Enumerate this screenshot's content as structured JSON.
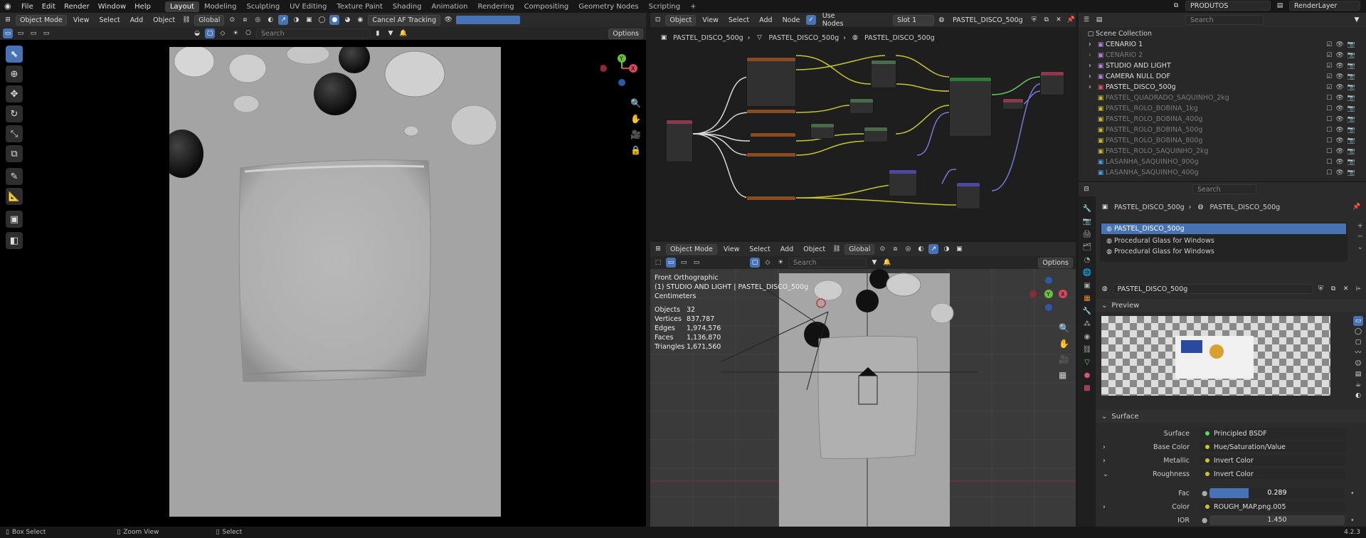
{
  "topbar": {
    "menus": [
      "File",
      "Edit",
      "Render",
      "Window",
      "Help"
    ],
    "workspaces": [
      "Layout",
      "Modeling",
      "Sculpting",
      "UV Editing",
      "Texture Paint",
      "Shading",
      "Animation",
      "Rendering",
      "Compositing",
      "Geometry Nodes",
      "Scripting"
    ],
    "active_workspace": "Layout",
    "add_tab": "+",
    "scene": "PRODUTOS",
    "view_layer": "RenderLayer"
  },
  "left_viewport": {
    "mode": "Object Mode",
    "menus": [
      "View",
      "Select",
      "Add",
      "Object"
    ],
    "transform": "Global",
    "cancel_af": "Cancel AF Tracking",
    "search_placeholder": "Search",
    "options": "Options"
  },
  "node_editor": {
    "object_selector": "Object",
    "menus": [
      "View",
      "Select",
      "Add",
      "Node"
    ],
    "use_nodes": "Use Nodes",
    "slot": "Slot 1",
    "material": "PASTEL_DISCO_500g",
    "breadcrumb": [
      "PASTEL_DISCO_500g",
      "PASTEL_DISCO_500g",
      "PASTEL_DISCO_500g"
    ]
  },
  "right_viewport": {
    "mode": "Object Mode",
    "menus": [
      "View",
      "Select",
      "Add",
      "Object"
    ],
    "transform": "Global",
    "search_placeholder": "Search",
    "options": "Options",
    "overlay": {
      "view_name": "Front Orthographic",
      "context": "(1) STUDIO AND LIGHT | PASTEL_DISCO_500g",
      "units": "Centimeters",
      "stats": [
        {
          "label": "Objects",
          "value": "32"
        },
        {
          "label": "Vertices",
          "value": "837,787"
        },
        {
          "label": "Edges",
          "value": "1,974,576"
        },
        {
          "label": "Faces",
          "value": "1,136,870"
        },
        {
          "label": "Triangles",
          "value": "1,671,560"
        }
      ]
    }
  },
  "outliner": {
    "search_placeholder": "Search",
    "root": "Scene Collection",
    "items": [
      {
        "name": "CENARIO 1",
        "color": "#b084d9",
        "dim": false,
        "checked": true
      },
      {
        "name": "CENARIO 2",
        "color": "#b084d9",
        "dim": true,
        "checked": true
      },
      {
        "name": "STUDIO AND LIGHT",
        "color": "#b084d9",
        "dim": false,
        "checked": true
      },
      {
        "name": "CAMERA NULL DOF",
        "color": "#b084d9",
        "dim": false,
        "checked": true
      },
      {
        "name": "PASTEL_DISCO_500g",
        "color": "#d9556b",
        "dim": false,
        "checked": true
      },
      {
        "name": "PASTEL_QUADRADO_SAQUINHO_2kg",
        "color": "#c7b837",
        "dim": true,
        "checked": false
      },
      {
        "name": "PASTEL_ROLO_BOBINA_1kg",
        "color": "#c7b837",
        "dim": true,
        "checked": false
      },
      {
        "name": "PASTEL_ROLO_BOBINA_400g",
        "color": "#c7b837",
        "dim": true,
        "checked": false
      },
      {
        "name": "PASTEL_ROLO_BOBINA_500g",
        "color": "#c7b837",
        "dim": true,
        "checked": false
      },
      {
        "name": "PASTEL_ROLO_BOBINA_800g",
        "color": "#c7b837",
        "dim": true,
        "checked": false
      },
      {
        "name": "PASTEL_ROLO_SAQUINHO_2kg",
        "color": "#c7b837",
        "dim": true,
        "checked": false
      },
      {
        "name": "LASANHA_SAQUINHO_900g",
        "color": "#4aa0d8",
        "dim": true,
        "checked": false
      },
      {
        "name": "LASANHA_SAQUINHO_400g",
        "color": "#4aa0d8",
        "dim": true,
        "checked": false
      }
    ]
  },
  "properties": {
    "search_placeholder": "Search",
    "breadcrumb": [
      "PASTEL_DISCO_500g",
      "PASTEL_DISCO_500g"
    ],
    "material_slots": [
      "PASTEL_DISCO_500g",
      "Procedural Glass for Windows",
      "Procedural Glass for Windows"
    ],
    "material_name": "PASTEL_DISCO_500g",
    "preview_label": "Preview",
    "surface_label": "Surface",
    "rows": [
      {
        "label": "Surface",
        "value": "Principled BSDF",
        "expand": false
      },
      {
        "label": "Base Color",
        "value": "Hue/Saturation/Value",
        "expand": true
      },
      {
        "label": "Metallic",
        "value": "Invert Color",
        "expand": true
      },
      {
        "label": "Roughness",
        "value": "Invert Color",
        "expand": true
      }
    ],
    "fac_label": "Fac",
    "fac_value": "0.289",
    "fac_fraction": 0.289,
    "color_label": "Color",
    "color_value": "ROUGH_MAP.png.005",
    "ior_label": "IOR",
    "ior_value": "1.450"
  },
  "statusbar": {
    "items": [
      "Box Select",
      "Zoom View",
      "Select"
    ],
    "version": "4.2.3"
  }
}
